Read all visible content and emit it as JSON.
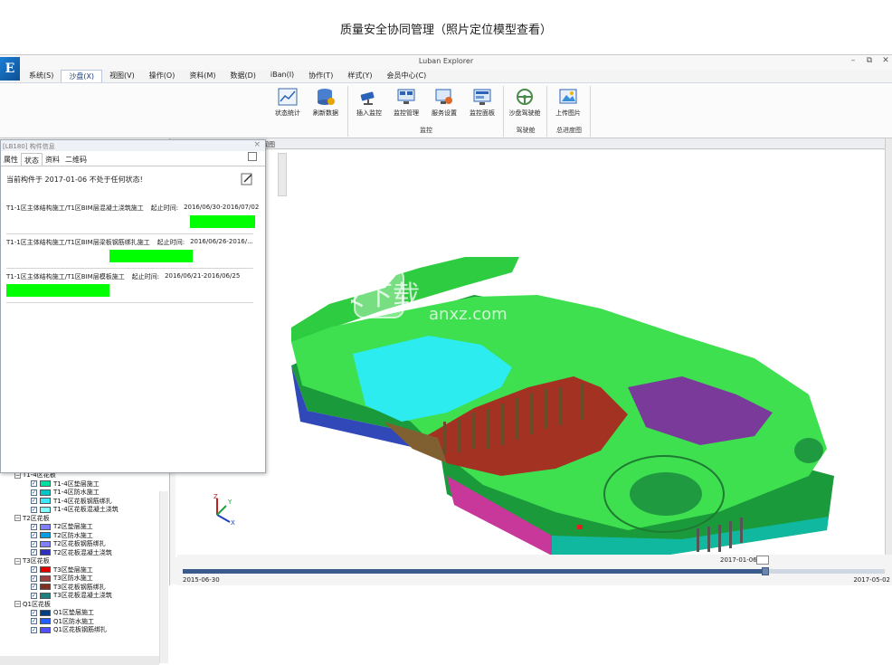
{
  "caption": "质量安全协同管理（照片定位模型查看）",
  "app": {
    "title": "Luban Explorer",
    "logo_text": "E",
    "window_controls": [
      "–",
      "⧉",
      "✕"
    ]
  },
  "menu": [
    {
      "label": "系统(S)",
      "active": false
    },
    {
      "label": "沙盘(X)",
      "active": true
    },
    {
      "label": "视图(V)",
      "active": false
    },
    {
      "label": "操作(O)",
      "active": false
    },
    {
      "label": "资料(M)",
      "active": false
    },
    {
      "label": "数据(D)",
      "active": false
    },
    {
      "label": "iBan(I)",
      "active": false
    },
    {
      "label": "协作(T)",
      "active": false
    },
    {
      "label": "样式(Y)",
      "active": false
    },
    {
      "label": "会员中心(C)",
      "active": false
    }
  ],
  "ribbon": {
    "buttons": [
      {
        "label": "状态统计",
        "icon": "chart-icon"
      },
      {
        "label": "刷新数据",
        "icon": "database-refresh-icon"
      },
      {
        "label": "插入监控",
        "icon": "camera-icon"
      },
      {
        "label": "监控管理",
        "icon": "monitor-manage-icon"
      },
      {
        "label": "服务设置",
        "icon": "service-settings-icon"
      },
      {
        "label": "监控面板",
        "icon": "monitor-panel-icon"
      },
      {
        "label": "沙盘驾驶舱",
        "icon": "steering-wheel-icon"
      },
      {
        "label": "上传图片",
        "icon": "image-upload-icon"
      }
    ],
    "groups": [
      "监控",
      "驾驶舱",
      "总进度图"
    ]
  },
  "popup": {
    "title": "[LB180] 构件信息",
    "tabs": [
      {
        "label": "属性",
        "active": false
      },
      {
        "label": "状态",
        "active": true
      },
      {
        "label": "资料",
        "active": false
      },
      {
        "label": "二维码",
        "active": false
      }
    ],
    "status_note": "当前构件于 2017-01-06 不处于任何状态!",
    "tasks": [
      {
        "name": "T1-1区主体结构施工/T1区BIM层混凝土浇筑施工",
        "time_label": "起止时间:",
        "time": "2016/06/30-2016/07/02",
        "progress": 1.0
      },
      {
        "name": "T1-1区主体结构施工/T1区BIM层梁板钢筋绑扎施工",
        "time_label": "起止时间:",
        "time": "2016/06/26-2016/...",
        "progress": 1.0
      },
      {
        "name": "T1-1区主体结构施工/T1区BIM层模板施工",
        "time_label": "起止时间:",
        "time": "2016/06/21-2016/06/25",
        "progress": 1.0
      }
    ]
  },
  "view_tab": "视图",
  "tree": {
    "groups": [
      {
        "label": "T1-4区花板",
        "items": [
          {
            "label": "T1-4区垫层施工",
            "color": "#00e0a0"
          },
          {
            "label": "T1-4区防水施工",
            "color": "#00c8c8"
          },
          {
            "label": "T1-4区花板钢筋绑扎",
            "color": "#3ee8ff"
          },
          {
            "label": "T1-4区花板混凝土浇筑",
            "color": "#80ffff"
          }
        ]
      },
      {
        "label": "T2区花板",
        "items": [
          {
            "label": "T2区垫层施工",
            "color": "#7f7fff"
          },
          {
            "label": "T2区防水施工",
            "color": "#00a0e0"
          },
          {
            "label": "T2区花板钢筋绑扎",
            "color": "#8080ff"
          },
          {
            "label": "T2区花板混凝土浇筑",
            "color": "#3030c0"
          }
        ]
      },
      {
        "label": "T3区花板",
        "items": [
          {
            "label": "T3区垫层施工",
            "color": "#e00000"
          },
          {
            "label": "T3区防水施工",
            "color": "#a04040"
          },
          {
            "label": "T3区花板钢筋绑扎",
            "color": "#803020"
          },
          {
            "label": "T3区花板混凝土浇筑",
            "color": "#208080"
          }
        ]
      },
      {
        "label": "Q1区花板",
        "items": [
          {
            "label": "Q1区垫层施工",
            "color": "#004080"
          },
          {
            "label": "Q1区防水施工",
            "color": "#2060ff"
          },
          {
            "label": "Q1区花板钢筋绑扎",
            "color": "#5050ff"
          }
        ]
      }
    ]
  },
  "watermark": {
    "cn": "安下载",
    "en": "anxz.com"
  },
  "axes": {
    "x": "X",
    "y": "Y",
    "z": "Z"
  },
  "timeline": {
    "start": "2015-06-30",
    "end": "2017-05-02",
    "current": "2017-01-06",
    "progress": 0.83
  }
}
